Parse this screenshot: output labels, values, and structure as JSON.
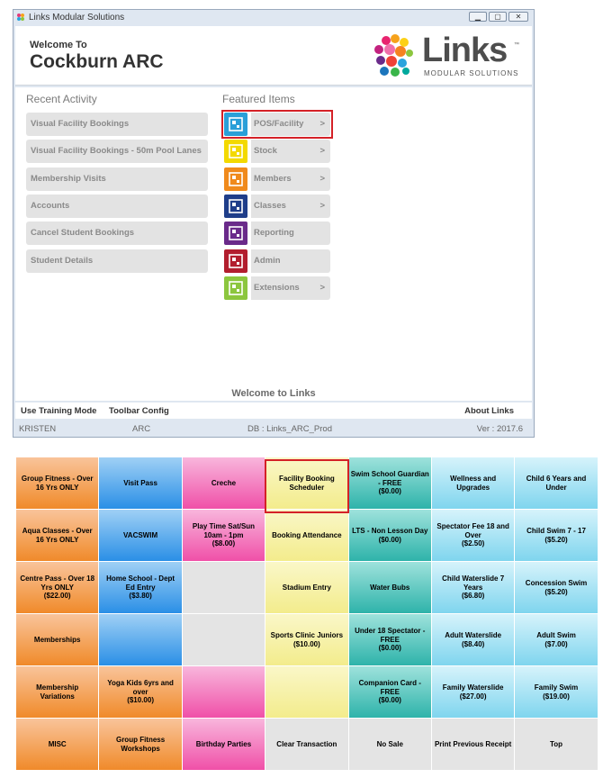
{
  "window": {
    "title": "Links Modular Solutions",
    "controls": [
      "minimize",
      "maximize",
      "close"
    ]
  },
  "header": {
    "welcome_to": "Welcome To",
    "site_name": "Cockburn ARC",
    "logo_text": "Links",
    "logo_tm": "™",
    "logo_sub": "MODULAR SOLUTIONS"
  },
  "recent": {
    "title": "Recent Activity",
    "items": [
      "Visual Facility Bookings",
      "Visual Facility Bookings - 50m Pool Lanes",
      "Membership Visits",
      "Accounts",
      "Cancel Student Bookings",
      "Student Details"
    ]
  },
  "featured": {
    "title": "Featured Items",
    "items": [
      {
        "label": "POS/Facility",
        "chevron": ">",
        "color": "#2a9fd8",
        "icon": "pos-icon",
        "selected": true
      },
      {
        "label": "Stock",
        "chevron": ">",
        "color": "#f3d900",
        "icon": "stock-icon"
      },
      {
        "label": "Members",
        "chevron": ">",
        "color": "#f08a1c",
        "icon": "members-icon"
      },
      {
        "label": "Classes",
        "chevron": ">",
        "color": "#1f3e8a",
        "icon": "classes-icon"
      },
      {
        "label": "Reporting",
        "chevron": "",
        "color": "#6a2a8a",
        "icon": "reporting-icon"
      },
      {
        "label": "Admin",
        "chevron": "",
        "color": "#b21e2e",
        "icon": "admin-icon"
      },
      {
        "label": "Extensions",
        "chevron": ">",
        "color": "#8cc63e",
        "icon": "extensions-icon"
      }
    ]
  },
  "footer": {
    "welcome_links": "Welcome to Links",
    "use_training_mode": "Use Training Mode",
    "toolbar_config": "Toolbar Config",
    "about_links": "About Links"
  },
  "status": {
    "user": "KRISTEN",
    "site": "ARC",
    "db": "DB : Links_ARC_Prod",
    "version": "Ver : 2017.6"
  },
  "pos_grid": {
    "selected_tile": "Facility Booking Scheduler",
    "rows": [
      [
        {
          "label": "Group Fitness - Over 16 Yrs ONLY",
          "price": "",
          "color": "orange"
        },
        {
          "label": "Visit Pass",
          "price": "",
          "color": "blue"
        },
        {
          "label": "Creche",
          "price": "",
          "color": "pink"
        },
        {
          "label": "Facility Booking Scheduler",
          "price": "",
          "color": "yellow"
        },
        {
          "label": "Swim School Guardian - FREE",
          "price": "($0.00)",
          "color": "teal"
        },
        {
          "label": "Wellness and Upgrades",
          "price": "",
          "color": "cyan"
        },
        {
          "label": "Child 6 Years and Under",
          "price": "",
          "color": "cyan"
        }
      ],
      [
        {
          "label": "Aqua Classes - Over 16 Yrs ONLY",
          "price": "",
          "color": "orange"
        },
        {
          "label": "VACSWIM",
          "price": "",
          "color": "blue"
        },
        {
          "label": "Play Time Sat/Sun 10am - 1pm",
          "price": "($8.00)",
          "color": "pink"
        },
        {
          "label": "Booking Attendance",
          "price": "",
          "color": "yellow"
        },
        {
          "label": "LTS - Non Lesson Day",
          "price": "($0.00)",
          "color": "teal"
        },
        {
          "label": "Spectator Fee 18 and Over",
          "price": "($2.50)",
          "color": "cyan"
        },
        {
          "label": "Child Swim 7 - 17",
          "price": "($5.20)",
          "color": "cyan"
        }
      ],
      [
        {
          "label": "Centre Pass - Over 18 Yrs ONLY",
          "price": "($22.00)",
          "color": "orange"
        },
        {
          "label": "Home School - Dept Ed Entry",
          "price": "($3.80)",
          "color": "blue"
        },
        {
          "label": "",
          "price": "",
          "color": "grey"
        },
        {
          "label": "Stadium Entry",
          "price": "",
          "color": "yellow"
        },
        {
          "label": "Water Bubs",
          "price": "",
          "color": "teal"
        },
        {
          "label": "Child Waterslide 7 Years",
          "price": "($6.80)",
          "color": "cyan"
        },
        {
          "label": "Concession Swim",
          "price": "($5.20)",
          "color": "cyan"
        }
      ],
      [
        {
          "label": "Memberships",
          "price": "",
          "color": "orange"
        },
        {
          "label": "",
          "price": "",
          "color": "blue"
        },
        {
          "label": "",
          "price": "",
          "color": "grey"
        },
        {
          "label": "Sports Clinic Juniors",
          "price": "($10.00)",
          "color": "yellow"
        },
        {
          "label": "Under 18 Spectator - FREE",
          "price": "($0.00)",
          "color": "teal"
        },
        {
          "label": "Adult Waterslide",
          "price": "($8.40)",
          "color": "cyan"
        },
        {
          "label": "Adult Swim",
          "price": "($7.00)",
          "color": "cyan"
        }
      ],
      [
        {
          "label": "Membership Variations",
          "price": "",
          "color": "orange"
        },
        {
          "label": "Yoga Kids 6yrs and over",
          "price": "($10.00)",
          "color": "orange"
        },
        {
          "label": "",
          "price": "",
          "color": "pink"
        },
        {
          "label": "",
          "price": "",
          "color": "yellow"
        },
        {
          "label": "Companion Card - FREE",
          "price": "($0.00)",
          "color": "teal"
        },
        {
          "label": "Family Waterslide",
          "price": "($27.00)",
          "color": "cyan"
        },
        {
          "label": "Family Swim",
          "price": "($19.00)",
          "color": "cyan"
        }
      ],
      [
        {
          "label": "MISC",
          "price": "",
          "color": "orange"
        },
        {
          "label": "Group Fitness Workshops",
          "price": "",
          "color": "orange"
        },
        {
          "label": "Birthday Parties",
          "price": "",
          "color": "pink"
        },
        {
          "label": "Clear Transaction",
          "price": "",
          "color": "grey"
        },
        {
          "label": "No Sale",
          "price": "",
          "color": "grey"
        },
        {
          "label": "Print Previous Receipt",
          "price": "",
          "color": "grey"
        },
        {
          "label": "Top",
          "price": "",
          "color": "grey"
        }
      ]
    ]
  }
}
